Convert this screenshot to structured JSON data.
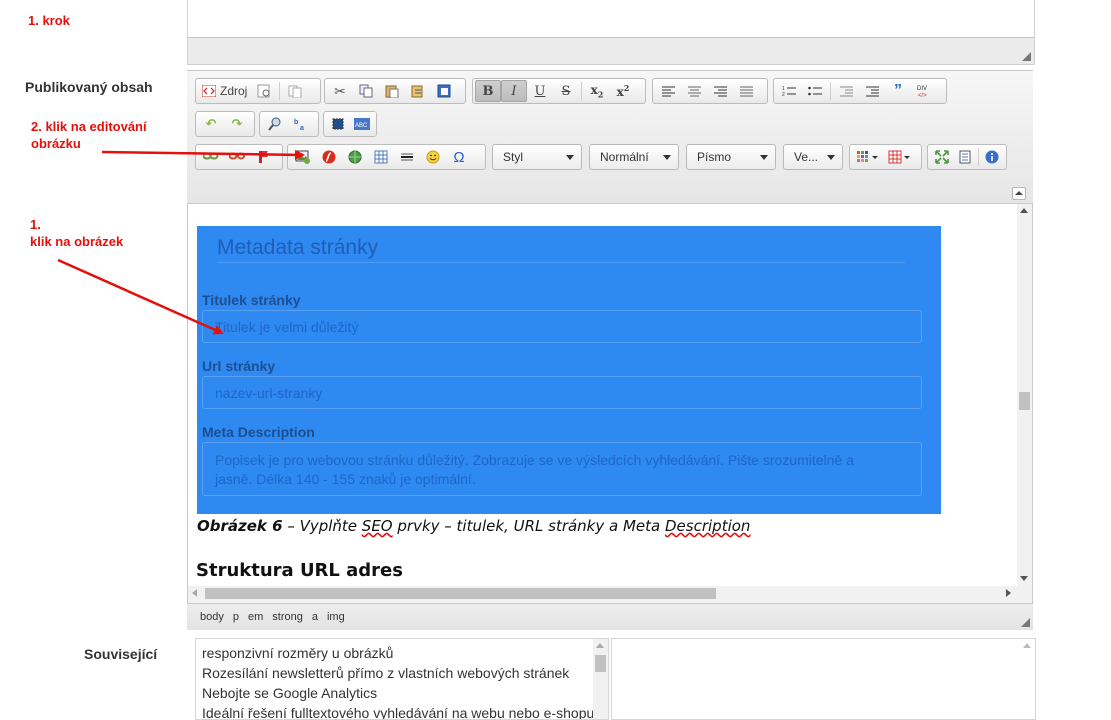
{
  "annotations": {
    "step1": "1. krok",
    "step2_line1": "2. klik na editování",
    "step2_line2": "obrázku",
    "click_num": "1.",
    "click_text": "klik na obrázek"
  },
  "labels": {
    "published": "Publikovaný obsah",
    "related": "Související"
  },
  "toolbar": {
    "source_label": "Zdroj",
    "style_combo": "Styl",
    "format_combo": "Normální",
    "font_combo": "Písmo",
    "size_combo": "Ve..."
  },
  "content": {
    "meta_title": "Metadata stránky",
    "field1_label": "Titulek stránky",
    "field1_value": "Titulek je velmi důležitý",
    "field2_label": "Url stránky",
    "field2_value": "nazev-url-stranky",
    "field3_label": "Meta Description",
    "field3_line1": "Popisek je pro webovou stránku důležitý. Zobrazuje se ve výsledcích vyhledávání. Pište srozumitelně a",
    "field3_line2": "jasně. Délka 140 - 155 znaků je optimální.",
    "caption_bold": "Obrázek 6",
    "caption_a": " – Vyplňte ",
    "caption_seo": "SEO",
    "caption_b": " prvky – titulek, URL stránky a Meta ",
    "caption_desc": "Description",
    "heading": "Struktura URL adres"
  },
  "path_elements": [
    "body",
    "p",
    "em",
    "strong",
    "a",
    "img"
  ],
  "related_items": [
    "responzivní rozměry u obrázků",
    "Rozesílání newsletterů přímo z vlastních webových stránek",
    "Nebojte se Google Analytics",
    "Ideální řešení fulltextového vyhledávání na webu nebo e-shopu"
  ],
  "colors": {
    "annotation_red": "#e4100b",
    "selection_blue": "#2e89f0"
  }
}
